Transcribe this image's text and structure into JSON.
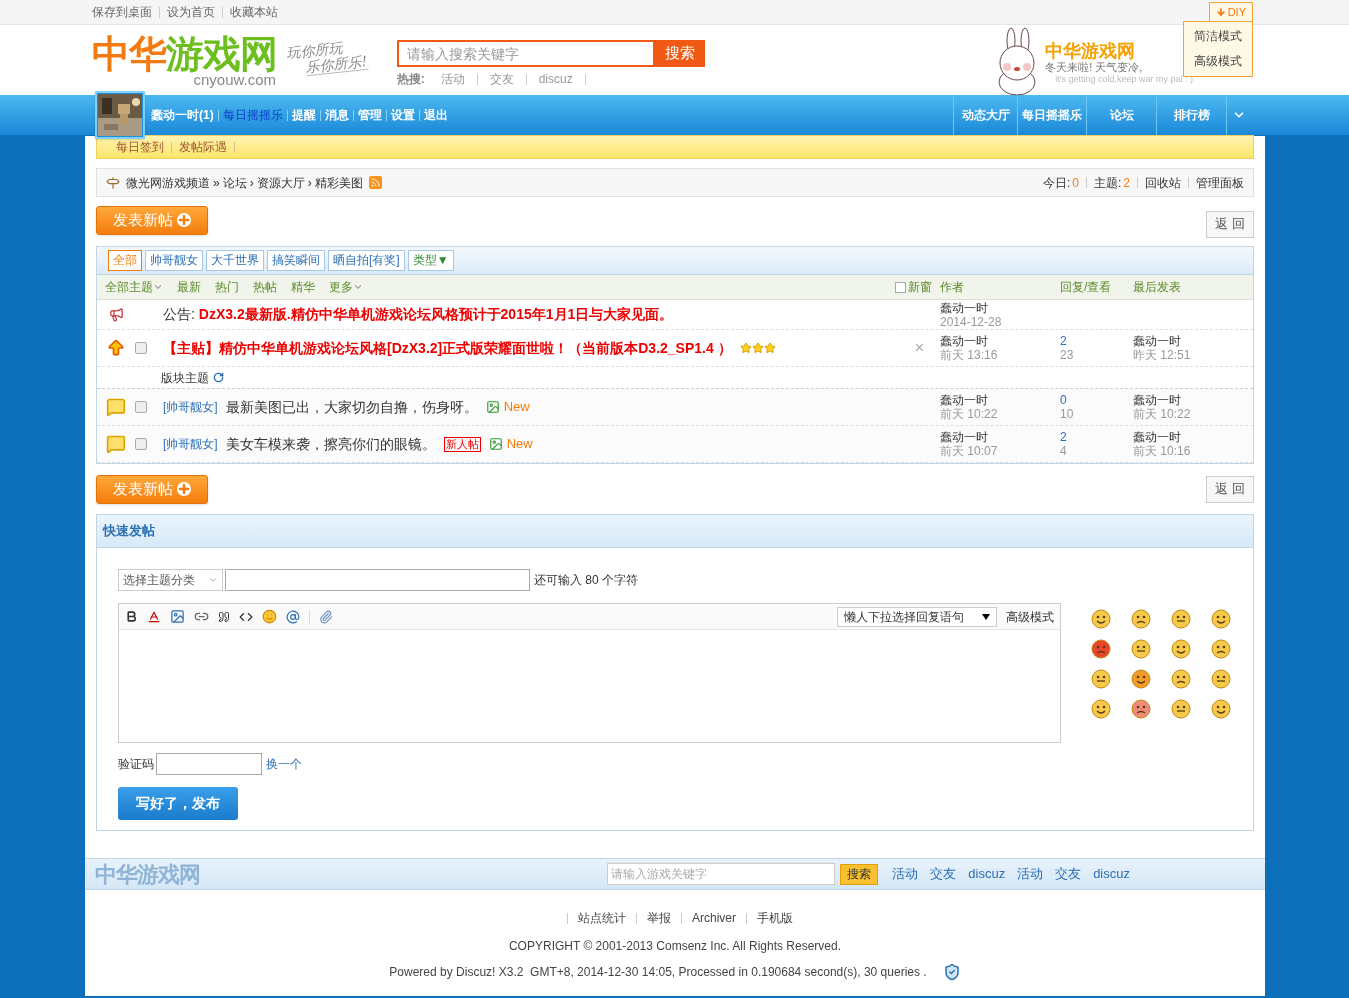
{
  "top_links": [
    "保存到桌面",
    "设为首页",
    "收藏本站"
  ],
  "logo": {
    "name_a": "中华",
    "name_b": "游戏网",
    "domain": "cnyouw.com",
    "slogan_1": "玩你所玩",
    "slogan_2": "乐你所乐!"
  },
  "search": {
    "placeholder": "请输入搜索关键字",
    "button": "搜索",
    "hot_label": "热搜:",
    "hot": [
      "活动",
      "交友",
      "discuz"
    ]
  },
  "mascot": {
    "title": "中华游戏网",
    "line1": "冬天来啦!  天气变冷,",
    "line2": "it's getting cold,keep war my pal : )"
  },
  "diy": {
    "label": "DIY",
    "options": [
      "简洁模式",
      "高级模式"
    ]
  },
  "user_links": [
    {
      "label": "蠢动一时(1)",
      "highlighted": false
    },
    {
      "label": "每日摇摇乐",
      "highlighted": true
    },
    {
      "label": "提醒",
      "highlighted": false
    },
    {
      "label": "消息",
      "highlighted": false
    },
    {
      "label": "管理",
      "highlighted": false
    },
    {
      "label": "设置",
      "highlighted": false
    },
    {
      "label": "退出",
      "highlighted": false
    }
  ],
  "main_nav": [
    "动态大厅",
    "每日摇摇乐",
    "论坛",
    "排行榜"
  ],
  "sub_nav": [
    "每日签到",
    "发帖际遇"
  ],
  "breadcrumb": [
    {
      "label": "微光网游戏频道"
    },
    {
      "separator": "»",
      "label": "论坛"
    },
    {
      "separator": "›",
      "label": "资源大厅"
    },
    {
      "separator": "›",
      "label": "精彩美图"
    }
  ],
  "stats": {
    "today_label": "今日:",
    "today": "0",
    "threads_label": "主题:",
    "threads": "2",
    "links": [
      "回收站",
      "管理面板"
    ]
  },
  "new_post_buttons": [
    "发表新帖",
    "发表新帖"
  ],
  "back_buttons": [
    "返 回",
    "返 回"
  ],
  "type_tabs": [
    {
      "label": "全部",
      "selected": true
    },
    {
      "label": "帅哥靓女",
      "selected": false
    },
    {
      "label": "大千世界",
      "selected": false
    },
    {
      "label": "搞笑瞬间",
      "selected": false
    },
    {
      "label": "晒自拍[有奖]",
      "selected": false
    }
  ],
  "type_menu": "类型▼",
  "filters": [
    {
      "label": "全部主题",
      "dropdown": true
    },
    {
      "label": "最新",
      "dropdown": false
    },
    {
      "label": "热门",
      "dropdown": false
    },
    {
      "label": "热帖",
      "dropdown": false
    },
    {
      "label": "精华",
      "dropdown": false
    },
    {
      "label": "更多",
      "dropdown": true
    }
  ],
  "columns": {
    "new_window": "新窗",
    "new_window_checked": false,
    "author": "作者",
    "replies": "回复/查看",
    "last_post": "最后发表"
  },
  "threads": [
    {
      "kind": "announcement",
      "prefix": "公告:",
      "title": "DzX3.2最新版.精仿中华单机游戏论坛风格预计于2015年1月1日与大家见面。",
      "author": "蠢动一时",
      "date": "2014-12-28"
    },
    {
      "kind": "sticky",
      "checked": false,
      "title": "【主贴】精仿中华单机游戏论坛风格[DzX3.2]正式版荣耀面世啦！（当前版本D3.2_SP1.4 ）",
      "stars": 3,
      "close": "×",
      "author": "蠢动一时",
      "date": "前天 13:16",
      "replies": "2",
      "views": "23",
      "last_author": "蠢动一时",
      "last_date": "昨天 12:51"
    },
    {
      "kind": "section",
      "label": "版块主题"
    },
    {
      "kind": "normal",
      "checked": false,
      "category": "[帅哥靓女]",
      "title": "最新美图已出，大家切勿自撸，伤身呀。",
      "new": "New",
      "author": "蠢动一时",
      "date": "前天 10:22",
      "replies": "0",
      "views": "10",
      "last_author": "蠢动一时",
      "last_date": "前天 10:22"
    },
    {
      "kind": "normal",
      "checked": false,
      "category": "[帅哥靓女]",
      "title": "美女车模来袭，擦亮你们的眼镜。",
      "tag": "新人帖",
      "new": "New",
      "author": "蠢动一时",
      "date": "前天 10:07",
      "replies": "2",
      "views": "4",
      "last_author": "蠢动一时",
      "last_date": "前天 10:16"
    }
  ],
  "quick_post": {
    "title": "快速发帖",
    "category_select": "选择主题分类",
    "counter": "还可输入 80 个字符",
    "reply_select": "懒人下拉选择回复语句",
    "advanced": "高级模式",
    "captcha_label": "验证码",
    "captcha_refresh": "换一个",
    "submit": "写好了，发布"
  },
  "footer": {
    "logo": "中华游戏网",
    "placeholder": "请输入游戏关键字",
    "button": "搜索",
    "links": [
      "活动",
      "交友",
      "discuz",
      "活动",
      "交友",
      "discuz"
    ],
    "bottom_links": [
      "站点统计",
      "举报",
      "Archiver",
      "手机版"
    ],
    "copyright": "COPYRIGHT © 2001-2013 Comsenz Inc. All Rights Reserved.",
    "powered": "Powered by Discuz! X3.2  GMT+8, 2014-12-30 14:05, Processed in 0.190684 second(s), 30 queries ."
  }
}
